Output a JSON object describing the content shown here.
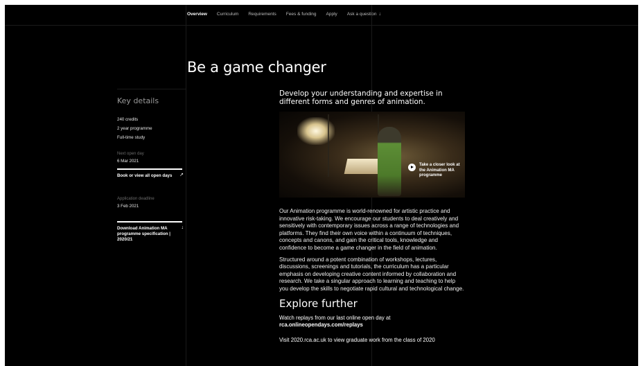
{
  "nav": {
    "items": [
      {
        "label": "Overview",
        "active": true
      },
      {
        "label": "Curriculum",
        "active": false
      },
      {
        "label": "Requirements",
        "active": false
      },
      {
        "label": "Fees & funding",
        "active": false
      },
      {
        "label": "Apply",
        "active": false
      },
      {
        "label": "Ask a question",
        "active": false
      }
    ],
    "ask_icon": "↓"
  },
  "title": "Be a game changer",
  "key_details": {
    "heading": "Key details",
    "items": [
      "240 credits",
      "2 year programme",
      "Full-time study"
    ],
    "open_day_label": "Next open day",
    "open_day_value": "6 Mar 2021",
    "open_day_link": "Book or view all open days",
    "open_day_link_icon": "↗",
    "deadline_label": "Application deadline",
    "deadline_value": "3 Feb 2021",
    "download_link": "Download Animation MA programme specification | 2020/21",
    "download_icon": "↓"
  },
  "main": {
    "lede": "Develop your understanding and expertise in different forms and genres of animation.",
    "video_label": "Take a closer look at the Animation MA programme",
    "paragraph1": "Our Animation programme is world-renowned for artistic practice and innovative risk-taking. We encourage our students to deal creatively and sensitively with contemporary issues across a range of technologies and platforms. They find their own voice within a continuum of techniques, concepts and canons, and gain the critical tools, knowledge and confidence to become a game changer in the field of animation.",
    "paragraph2": "Structured around a potent combination of workshops, lectures, discussions, screenings and tutorials, the curriculum has a particular emphasis on developing creative content informed by collaboration and research. We take a singular approach to learning and teaching to help you develop the skills to negotiate rapid cultural and technological change.",
    "explore_heading": "Explore further",
    "explore_text": "Watch replays from our last online open day at",
    "explore_link": "rca.onlineopendays.com/replays",
    "cut_text": "Visit 2020.rca.ac.uk to view graduate work from the class of 2020"
  }
}
